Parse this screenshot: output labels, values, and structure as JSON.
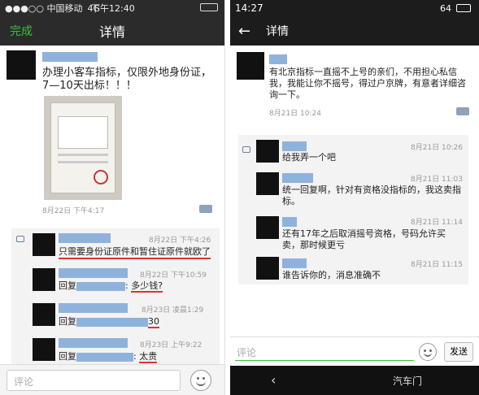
{
  "left": {
    "status": {
      "carrier": "●●●○○ 中国移动",
      "network": "4G",
      "time": "下午12:40"
    },
    "nav": {
      "done": "完成",
      "title": "详情"
    },
    "post": {
      "text": "办理小客车指标，仅限外地身份证，7—10天出标！！！",
      "time": "8月22日 下午4:17"
    },
    "comments": [
      {
        "time": "8月22日 下午4:26",
        "text": "只需要身份证原件和暂住证原件就欧了"
      },
      {
        "time": "8月22日 下午10:59",
        "prefix": "回复",
        "suffix": ": ",
        "reply": "多少钱?"
      },
      {
        "time": "8月23日 凌晨1:29",
        "prefix": "回复",
        "suffix": "",
        "reply": "30"
      },
      {
        "time": "8月23日 上午9:22",
        "prefix": "回复",
        "suffix": ": ",
        "reply": "太贵"
      }
    ],
    "comment_placeholder": "评论"
  },
  "right": {
    "status": {
      "time": "14:27",
      "battery": "64"
    },
    "nav": {
      "title": "详情"
    },
    "post": {
      "text": "有北京指标一直摇不上号的亲们，不用担心私信我，我能让你不摇号，得过户京牌，有意者详细咨询一下。",
      "time": "8月21日 10:24"
    },
    "comments": [
      {
        "time": "8月21日 10:26",
        "text": "给我弄一个吧"
      },
      {
        "time": "8月21日 11:03",
        "text": "统一回复啊，针对有资格没指标的，我这卖指标。"
      },
      {
        "time": "8月21日 11:14",
        "text": "还有17年之后取消摇号资格，号码允许买卖，那时候更亏"
      },
      {
        "time": "8月21日 11:15",
        "text": "谁告诉你的，消息准确不"
      }
    ],
    "comment_placeholder": "评论",
    "send": "发送",
    "watermark": "汽车门"
  }
}
